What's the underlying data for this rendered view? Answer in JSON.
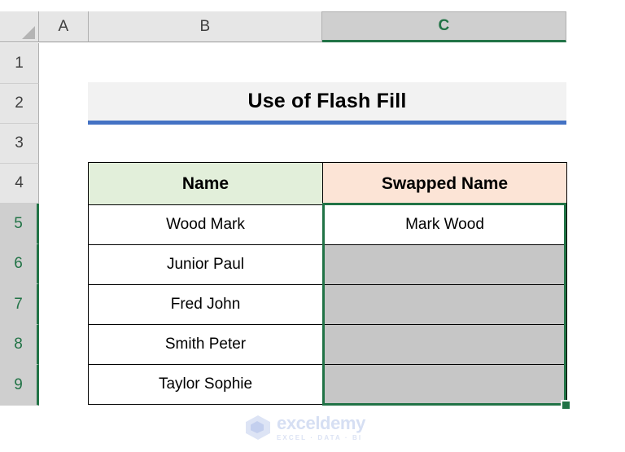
{
  "app": {
    "type": "spreadsheet",
    "select_all_corner": "select-all"
  },
  "columns": [
    {
      "label": "A",
      "selected": false
    },
    {
      "label": "B",
      "selected": false
    },
    {
      "label": "C",
      "selected": true
    }
  ],
  "rows": [
    {
      "label": "1",
      "selected": false
    },
    {
      "label": "2",
      "selected": false
    },
    {
      "label": "3",
      "selected": false
    },
    {
      "label": "4",
      "selected": false
    },
    {
      "label": "5",
      "selected": true
    },
    {
      "label": "6",
      "selected": true
    },
    {
      "label": "7",
      "selected": true
    },
    {
      "label": "8",
      "selected": true
    },
    {
      "label": "9",
      "selected": true
    }
  ],
  "title_banner": {
    "text": "Use of Flash Fill",
    "background": "#F2F2F2",
    "underline_color": "#4472C4"
  },
  "table": {
    "headers": [
      {
        "label": "Name",
        "background": "#E2EFDA"
      },
      {
        "label": "Swapped Name",
        "background": "#FCE4D6"
      }
    ],
    "rows": [
      {
        "name": "Wood Mark",
        "swapped": "Mark Wood",
        "swapped_filled": true
      },
      {
        "name": "Junior Paul",
        "swapped": "",
        "swapped_filled": false
      },
      {
        "name": "Fred John",
        "swapped": "",
        "swapped_filled": false
      },
      {
        "name": "Smith Peter",
        "swapped": "",
        "swapped_filled": false
      },
      {
        "name": "Taylor Sophie",
        "swapped": "",
        "swapped_filled": false
      }
    ]
  },
  "selection": {
    "range": "C5:C9",
    "border_color": "#217346",
    "selected_cell_fill": "#C6C6C6",
    "fill_handle": "fill-handle"
  },
  "watermark": {
    "brand": "exceldemy",
    "tagline": "EXCEL · DATA · BI",
    "color": "#D6DFF3"
  }
}
